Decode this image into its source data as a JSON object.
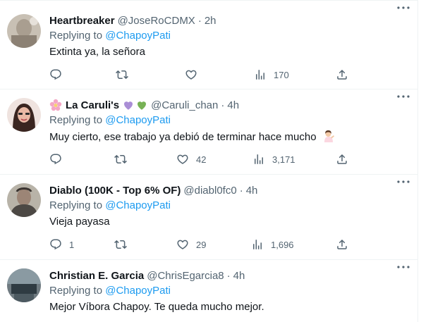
{
  "tweets": [
    {
      "name": "Heartbreaker",
      "handle": "@JoseRoCDMX",
      "separator": "·",
      "time": "2h",
      "replying_prefix": "Replying to",
      "replying_to": "@ChapoyPati",
      "text": "Extinta ya, la señora",
      "replies": "",
      "retweets": "",
      "likes": "",
      "views": "170"
    },
    {
      "name": "La Caruli's",
      "name_prefix_icon": "flower-emoji-icon",
      "name_suffix_icons": [
        "purple-heart-emoji-icon",
        "green-heart-emoji-icon"
      ],
      "handle": "@Caruli_chan",
      "separator": "·",
      "time": "4h",
      "replying_prefix": "Replying to",
      "replying_to": "@ChapoyPati",
      "text": "Muy cierto, ese trabajo ya debió de terminar  hace mucho",
      "text_emoji_icon": "person-tipping-hand-emoji-icon",
      "replies": "",
      "retweets": "",
      "likes": "42",
      "views": "3,171"
    },
    {
      "name": "Diablo (100K - Top 6% OF)",
      "handle": "@diabl0fc0",
      "separator": "·",
      "time": "4h",
      "replying_prefix": "Replying to",
      "replying_to": "@ChapoyPati",
      "text": "Vieja payasa",
      "replies": "1",
      "retweets": "",
      "likes": "29",
      "views": "1,696"
    },
    {
      "name": "Christian E. Garcia",
      "handle": "@ChrisEgarcia8",
      "separator": "·",
      "time": "4h",
      "replying_prefix": "Replying to",
      "replying_to": "@ChapoyPati",
      "text": "Mejor Víbora Chapoy. Te queda mucho mejor."
    }
  ],
  "colors": {
    "link": "#1d9bf0",
    "secondary_text": "#536471",
    "primary_text": "#0f1419",
    "divider": "#eff3f4"
  }
}
